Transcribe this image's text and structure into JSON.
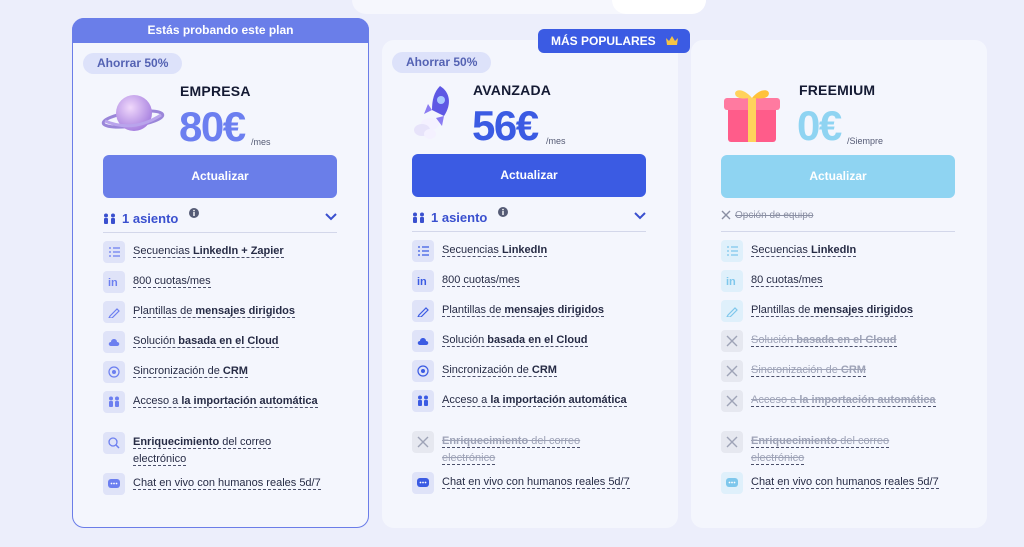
{
  "colors": {
    "accent": "#3b5be3",
    "empresa_primary": "#6a7ee9",
    "freemium_primary": "#8fd4f2",
    "price_empresa": "#6c7ff0",
    "price_avanzada": "#3b5be3",
    "price_freemium": "#8fd4f2"
  },
  "trial_banner": "Estás probando este plan",
  "popular_badge": "MÁS POPULARES",
  "plans": [
    {
      "name": "EMPRESA",
      "save": "Ahorrar 50%",
      "price": "80€",
      "period": "/mes",
      "cta": "Actualizar",
      "seats": "1 asiento",
      "icon": "planet-icon",
      "features": [
        {
          "pre": "Secuencias ",
          "bold": "LinkedIn + Zapier",
          "post": "",
          "icon": "list-icon"
        },
        {
          "pre": "800 cuotas/mes",
          "bold": "",
          "post": "",
          "icon": "linkedin-icon"
        },
        {
          "pre": "Plantillas de ",
          "bold": "mensajes dirigidos",
          "post": "",
          "icon": "pen-icon"
        },
        {
          "pre": "Solución ",
          "bold": "basada en el Cloud",
          "post": "",
          "icon": "cloud-icon"
        },
        {
          "pre": "Sincronización de ",
          "bold": "CRM",
          "post": "",
          "icon": "sync-icon"
        },
        {
          "pre": "Acceso a ",
          "bold": "la importación automática",
          "post": "",
          "icon": "people-icon"
        },
        {
          "pre": "",
          "bold": "Enriquecimiento",
          "post": " del correo electrónico",
          "icon": "search-icon"
        },
        {
          "pre": "Chat en vivo con humanos reales 5d/7",
          "bold": "",
          "post": "",
          "icon": "chat-icon"
        }
      ]
    },
    {
      "name": "AVANZADA",
      "save": "Ahorrar 50%",
      "price": "56€",
      "period": "/mes",
      "cta": "Actualizar",
      "seats": "1 asiento",
      "icon": "rocket-icon",
      "features": [
        {
          "pre": "Secuencias ",
          "bold": "LinkedIn",
          "post": "",
          "icon": "list-icon"
        },
        {
          "pre": "800 cuotas/mes",
          "bold": "",
          "post": "",
          "icon": "linkedin-icon"
        },
        {
          "pre": "Plantillas de ",
          "bold": "mensajes dirigidos",
          "post": "",
          "icon": "pen-icon"
        },
        {
          "pre": "Solución ",
          "bold": "basada en el Cloud",
          "post": "",
          "icon": "cloud-icon"
        },
        {
          "pre": "Sincronización de ",
          "bold": "CRM",
          "post": "",
          "icon": "sync-icon"
        },
        {
          "pre": "Acceso a ",
          "bold": "la importación automática",
          "post": "",
          "icon": "people-icon"
        },
        {
          "pre": "",
          "bold": "Enriquecimiento",
          "post": " del correo electrónico",
          "icon": "close-icon",
          "off": true
        },
        {
          "pre": "Chat en vivo con humanos reales 5d/7",
          "bold": "",
          "post": "",
          "icon": "chat-icon"
        }
      ]
    },
    {
      "name": "FREEMIUM",
      "price": "0€",
      "period": "/Siempre",
      "cta": "Actualizar",
      "team_option": "Opción de equipo",
      "icon": "gift-icon",
      "features": [
        {
          "pre": "Secuencias ",
          "bold": "LinkedIn",
          "post": "",
          "icon": "list-icon"
        },
        {
          "pre": "80 cuotas/mes",
          "bold": "",
          "post": "",
          "icon": "linkedin-icon"
        },
        {
          "pre": "Plantillas de ",
          "bold": "mensajes dirigidos",
          "post": "",
          "icon": "pen-icon"
        },
        {
          "pre": "Solución ",
          "bold": "basada en el Cloud",
          "post": "",
          "icon": "close-icon",
          "off": true
        },
        {
          "pre": "Sincronización de ",
          "bold": "CRM",
          "post": "",
          "icon": "close-icon",
          "off": true
        },
        {
          "pre": "Acceso a ",
          "bold": "la importación automática",
          "post": "",
          "icon": "close-icon",
          "off": true
        },
        {
          "pre": "",
          "bold": "Enriquecimiento",
          "post": " del correo electrónico",
          "icon": "close-icon",
          "off": true
        },
        {
          "pre": "Chat en vivo con humanos reales 5d/7",
          "bold": "",
          "post": "",
          "icon": "chat-icon"
        }
      ]
    }
  ]
}
